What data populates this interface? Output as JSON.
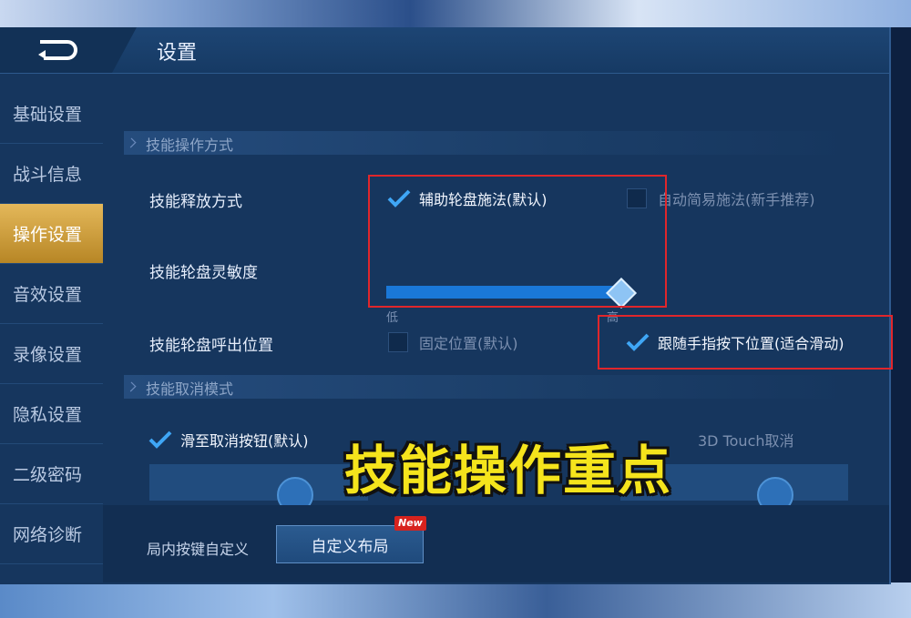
{
  "header": {
    "title": "设置",
    "back_icon": "back-arrow-icon"
  },
  "sidebar": {
    "items": [
      {
        "label": "基础设置",
        "active": false
      },
      {
        "label": "战斗信息",
        "active": false
      },
      {
        "label": "操作设置",
        "active": true
      },
      {
        "label": "音效设置",
        "active": false
      },
      {
        "label": "录像设置",
        "active": false
      },
      {
        "label": "隐私设置",
        "active": false
      },
      {
        "label": "二级密码",
        "active": false
      },
      {
        "label": "网络诊断",
        "active": false
      }
    ]
  },
  "sections": {
    "skill_mode": {
      "title": "技能操作方式"
    },
    "skill_cancel": {
      "title": "技能取消模式"
    }
  },
  "rows": {
    "release": {
      "label": "技能释放方式",
      "option_a": {
        "label": "辅助轮盘施法(默认)",
        "checked": true
      },
      "option_b": {
        "label": "自动简易施法(新手推荐)",
        "checked": false
      }
    },
    "sensitivity": {
      "label": "技能轮盘灵敏度",
      "low_label": "低",
      "high_label": "高",
      "value_fraction": 1.0
    },
    "wheel_position": {
      "label": "技能轮盘呼出位置",
      "option_a": {
        "label": "固定位置(默认)",
        "checked": false
      },
      "option_b": {
        "label": "跟随手指按下位置(适合滑动)",
        "checked": true
      }
    },
    "cancel": {
      "option_a": {
        "label": "滑至取消按钮(默认)",
        "checked": true
      },
      "option_c_partial": "3D Touch取消"
    }
  },
  "bottom": {
    "label": "局内按键自定义",
    "button_label": "自定义布局",
    "badge": "New"
  },
  "overlay": {
    "caption": "技能操作重点"
  },
  "colors": {
    "accent_gold": "#c8962f",
    "highlight_red": "#e0262b",
    "caption_yellow": "#f5e41c",
    "slider_blue": "#1a78d8"
  }
}
